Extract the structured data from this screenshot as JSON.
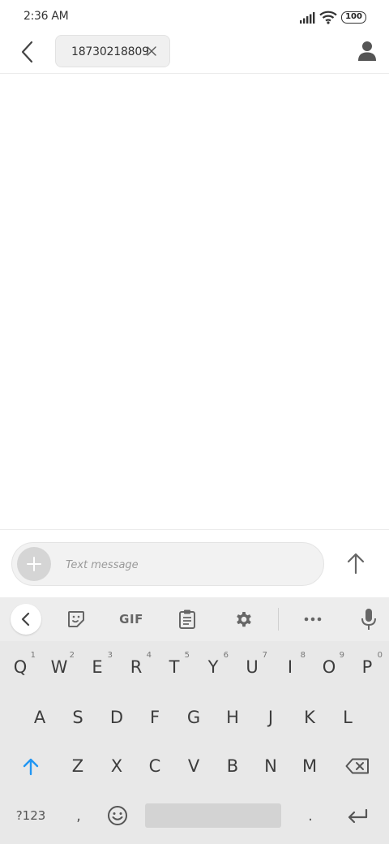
{
  "status_bar": {
    "time": "2:36 AM",
    "battery": "100"
  },
  "header": {
    "recipient": "18730218809"
  },
  "compose": {
    "placeholder": "Text message"
  },
  "keyboard": {
    "toolbar": {
      "gif_label": "GIF"
    },
    "row1": [
      {
        "key": "Q",
        "hint": "1"
      },
      {
        "key": "W",
        "hint": "2"
      },
      {
        "key": "E",
        "hint": "3"
      },
      {
        "key": "R",
        "hint": "4"
      },
      {
        "key": "T",
        "hint": "5"
      },
      {
        "key": "Y",
        "hint": "6"
      },
      {
        "key": "U",
        "hint": "7"
      },
      {
        "key": "I",
        "hint": "8"
      },
      {
        "key": "O",
        "hint": "9"
      },
      {
        "key": "P",
        "hint": "0"
      }
    ],
    "row2": [
      "A",
      "S",
      "D",
      "F",
      "G",
      "H",
      "J",
      "K",
      "L"
    ],
    "row3": [
      "Z",
      "X",
      "C",
      "V",
      "B",
      "N",
      "M"
    ],
    "bottom": {
      "symbols": "?123",
      "comma": ",",
      "period": "."
    }
  },
  "colors": {
    "accent": "#2196F3",
    "background": "#FFFFFF",
    "keyboard": "#E8E8E8"
  }
}
